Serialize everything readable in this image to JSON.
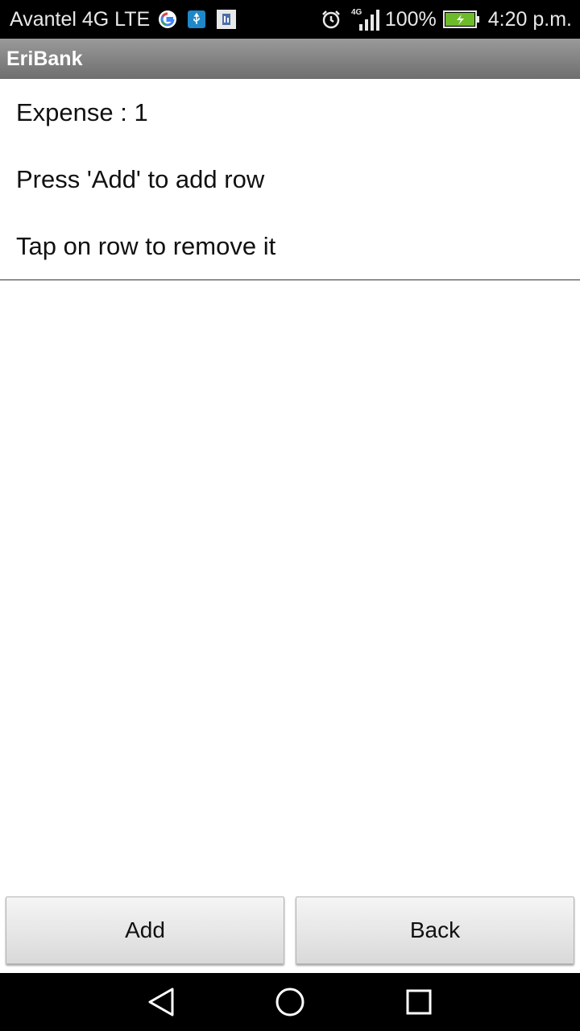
{
  "status_bar": {
    "carrier": "Avantel 4G LTE",
    "network_badge": "4G",
    "battery": "100%",
    "time": "4:20 p.m.",
    "icons": [
      "google-icon",
      "usb-icon",
      "sim-app-icon",
      "alarm-icon",
      "signal-icon",
      "battery-icon"
    ]
  },
  "action_bar": {
    "title": "EriBank"
  },
  "list": {
    "items": [
      "Expense : 1",
      "Press 'Add' to add row",
      "Tap on row to remove it"
    ]
  },
  "buttons": {
    "add": "Add",
    "back": "Back"
  },
  "nav": {
    "icons": [
      "back-icon",
      "home-icon",
      "recents-icon"
    ]
  },
  "colors": {
    "action_bar": "#808080",
    "status_bar": "#000000",
    "battery_fill": "#6dbb2a"
  }
}
